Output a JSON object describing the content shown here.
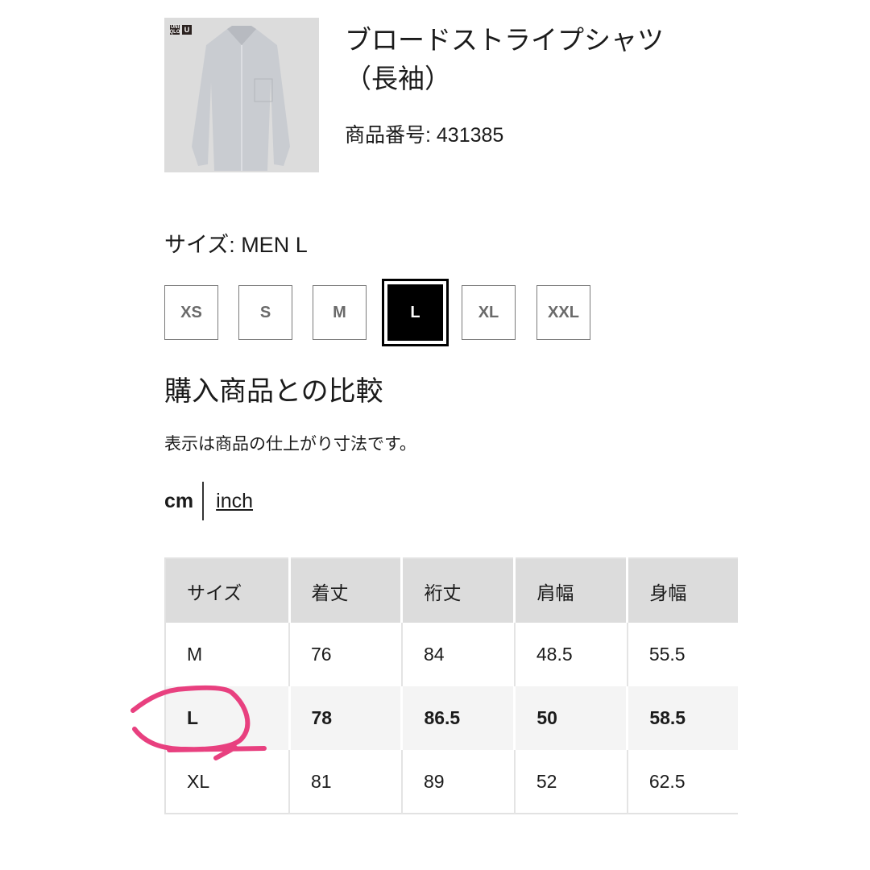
{
  "product": {
    "title": "ブロードストライプシャツ（長袖）",
    "code": "商品番号: 431385",
    "logos": [
      "UNIQLO",
      "U"
    ]
  },
  "size_label": "サイズ: MEN L",
  "sizes": [
    {
      "label": "XS"
    },
    {
      "label": "S"
    },
    {
      "label": "M"
    },
    {
      "label": "L",
      "selected": true
    },
    {
      "label": "XL"
    },
    {
      "label": "XXL"
    }
  ],
  "compare_title": "購入商品との比較",
  "note": "表示は商品の仕上がり寸法です。",
  "units": {
    "cm": "cm",
    "inch": "inch",
    "selected": "cm"
  },
  "table": {
    "headers": [
      "サイズ",
      "着丈",
      "裄丈",
      "肩幅",
      "身幅"
    ],
    "rows": [
      [
        "M",
        "76",
        "84",
        "48.5",
        "55.5"
      ],
      [
        "L",
        "78",
        "86.5",
        "50",
        "58.5"
      ],
      [
        "XL",
        "81",
        "89",
        "52",
        "62.5"
      ]
    ],
    "highlighted_row": "L"
  },
  "annotation": {
    "color": "#e8407f",
    "target": "L"
  }
}
